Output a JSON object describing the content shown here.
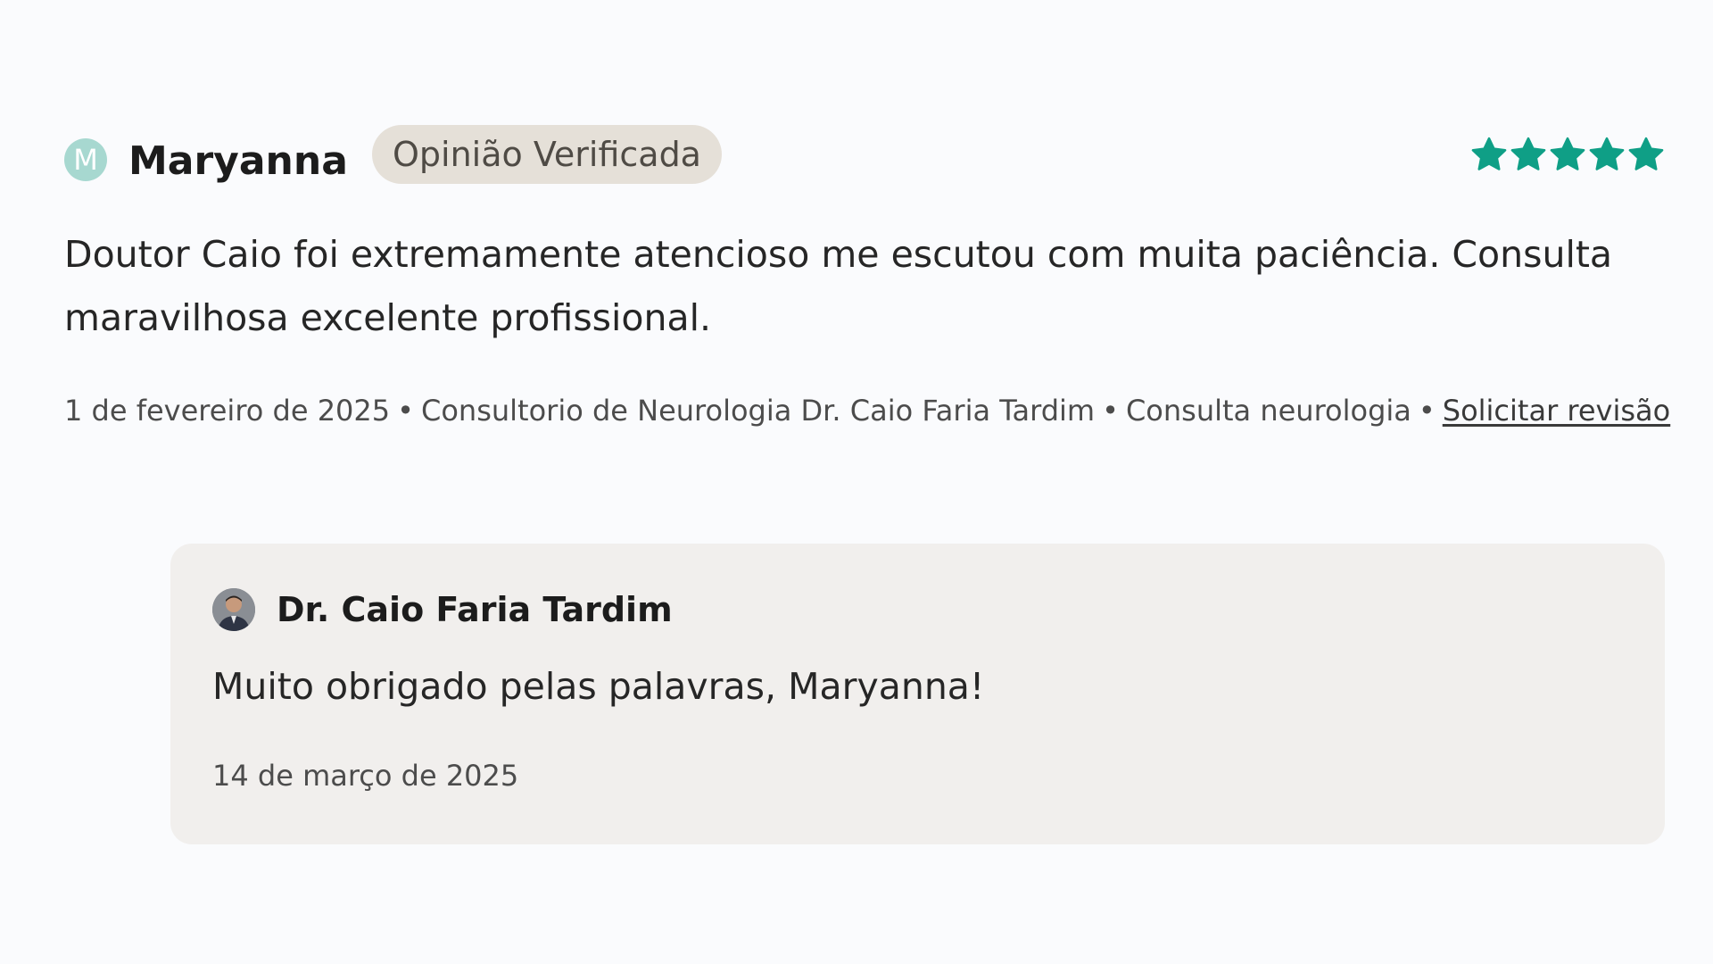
{
  "review": {
    "avatar_letter": "M",
    "reviewer_name": "Maryanna",
    "badge": "Opinião Verificada",
    "rating": 5,
    "rating_max": 5,
    "star_color": "#0f9f86",
    "star_icon": "star-icon",
    "text": "Doutor Caio foi extremamente atencioso me escutou com muita paciência. Consulta maravilhosa excelente profissional.",
    "meta": {
      "date": "1 de fevereiro de 2025",
      "clinic": "Consultorio de Neurologia Dr. Caio Faria Tardim",
      "service": "Consulta neurologia",
      "separator": "•",
      "request_review_link": "Solicitar revisão"
    }
  },
  "reply": {
    "author": "Dr. Caio Faria Tardim",
    "text": "Muito obrigado pelas palavras, Maryanna!",
    "date": "14 de março de 2025"
  }
}
